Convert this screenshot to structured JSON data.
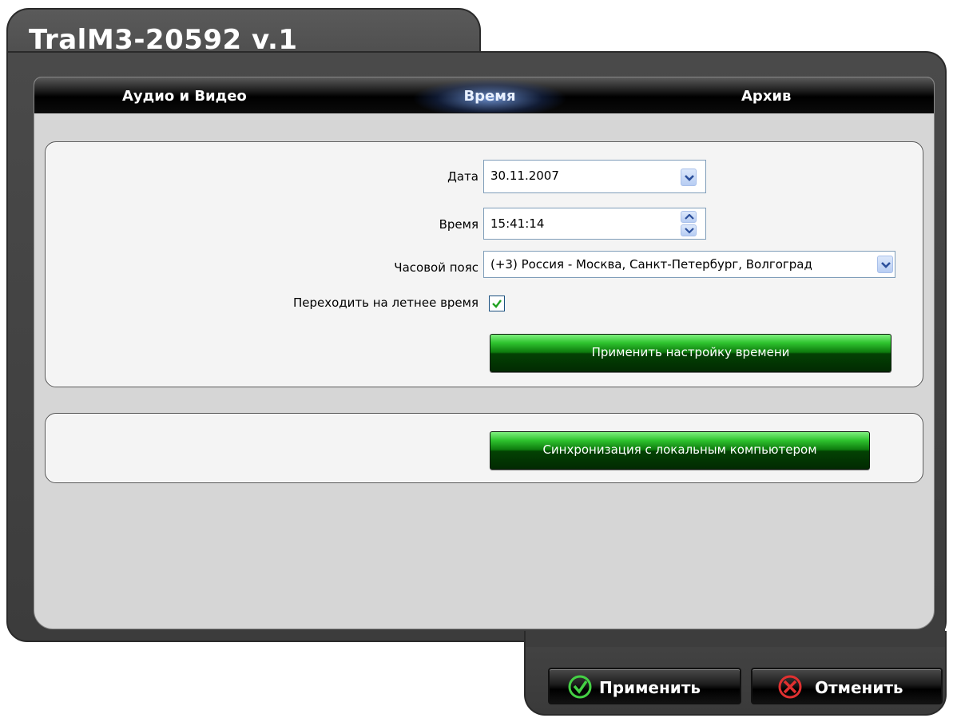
{
  "app": {
    "title": "TralM3-20592 v.1"
  },
  "tabs": [
    {
      "label": "Аудио и Видео"
    },
    {
      "label": "Время"
    },
    {
      "label": "Архив"
    }
  ],
  "time_settings": {
    "date_label": "Дата",
    "date_value": "30.11.2007",
    "time_label": "Время",
    "time_value": "15:41:14",
    "timezone_label": "Часовой пояс",
    "timezone_value": "(+3) Россия - Москва, Санкт-Петербург, Волгоград",
    "dst_label": "Переходить на летнее время",
    "dst_checked": true,
    "apply_time_button": "Применить настройку времени"
  },
  "sync": {
    "sync_button": "Синхронизация с локальным компьютером"
  },
  "footer": {
    "apply_label": "Применить",
    "cancel_label": "Отменить"
  },
  "colors": {
    "apply_icon": "#44d044",
    "cancel_icon": "#e03030",
    "active_tab_glow": "#78a0e6"
  }
}
